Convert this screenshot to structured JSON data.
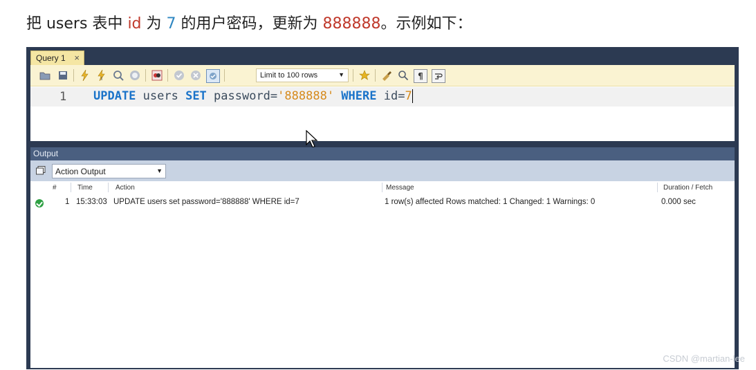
{
  "instruction": {
    "part1": "把 users 表中 ",
    "field": "id",
    "part2": " 为 ",
    "id_value": "7",
    "part3": " 的用户密码，更新为 ",
    "new_password": "888888",
    "part4": "。示例如下："
  },
  "query_tab": {
    "label": "Query 1",
    "close_glyph": "×"
  },
  "toolbar": {
    "limit_select_value": "Limit to 100 rows",
    "icons": [
      "open-folder-icon",
      "save-icon",
      "execute-icon",
      "execute-current-icon",
      "explain-icon",
      "stop-icon",
      "toggle-results-icon",
      "commit-icon",
      "rollback-icon",
      "autocommit-icon",
      "favorite-icon",
      "beautify-icon",
      "find-icon",
      "invisible-chars-icon",
      "wrap-icon"
    ]
  },
  "editor": {
    "line_number": "1",
    "code": {
      "kw_update": "UPDATE",
      "table": " users ",
      "kw_set": "SET",
      "col_password": " password",
      "eq1": "=",
      "str_value": "'888888'",
      "kw_where": " WHERE",
      "col_id": " id",
      "eq2": "=",
      "num_value": "7"
    }
  },
  "output": {
    "title": "Output",
    "select_value": "Action Output",
    "columns": {
      "num": "#",
      "time": "Time",
      "action": "Action",
      "message": "Message",
      "duration": "Duration / Fetch"
    },
    "rows": [
      {
        "status": "success",
        "num": "1",
        "time": "15:33:03",
        "action": "UPDATE users set password='888888' WHERE id=7",
        "message": "1 row(s) affected Rows matched: 1  Changed: 1  Warnings: 0",
        "duration": "0.000 sec"
      }
    ]
  },
  "watermark": "CSDN @martian-lee",
  "colors": {
    "frame": "#2c3a52",
    "toolbar": "#faf3d2",
    "tab": "#f5e6a3",
    "keyword": "#1a73c9",
    "string": "#d68a1c",
    "output_header": "#4a5f80",
    "success": "#2ea043"
  }
}
